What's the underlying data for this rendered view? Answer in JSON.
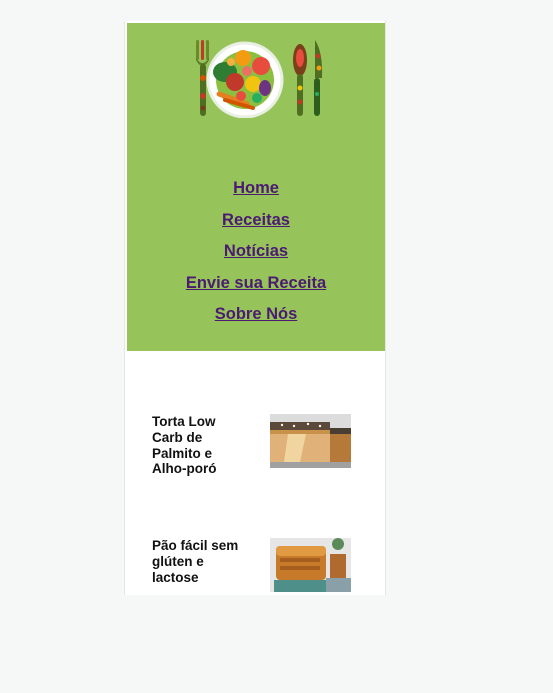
{
  "nav": {
    "items": [
      {
        "label": "Home"
      },
      {
        "label": "Receitas"
      },
      {
        "label": "Notícias"
      },
      {
        "label": "Envie sua Receita"
      },
      {
        "label": "Sobre Nós"
      }
    ]
  },
  "recipes": [
    {
      "title": "Torta Low Carb de Palmito e Alho-poró"
    },
    {
      "title": "Pão fácil sem glúten e lactose"
    }
  ],
  "colors": {
    "header_bg": "#97c45a",
    "nav_link": "#4b1a72",
    "page_bg": "#f6f7f7"
  }
}
